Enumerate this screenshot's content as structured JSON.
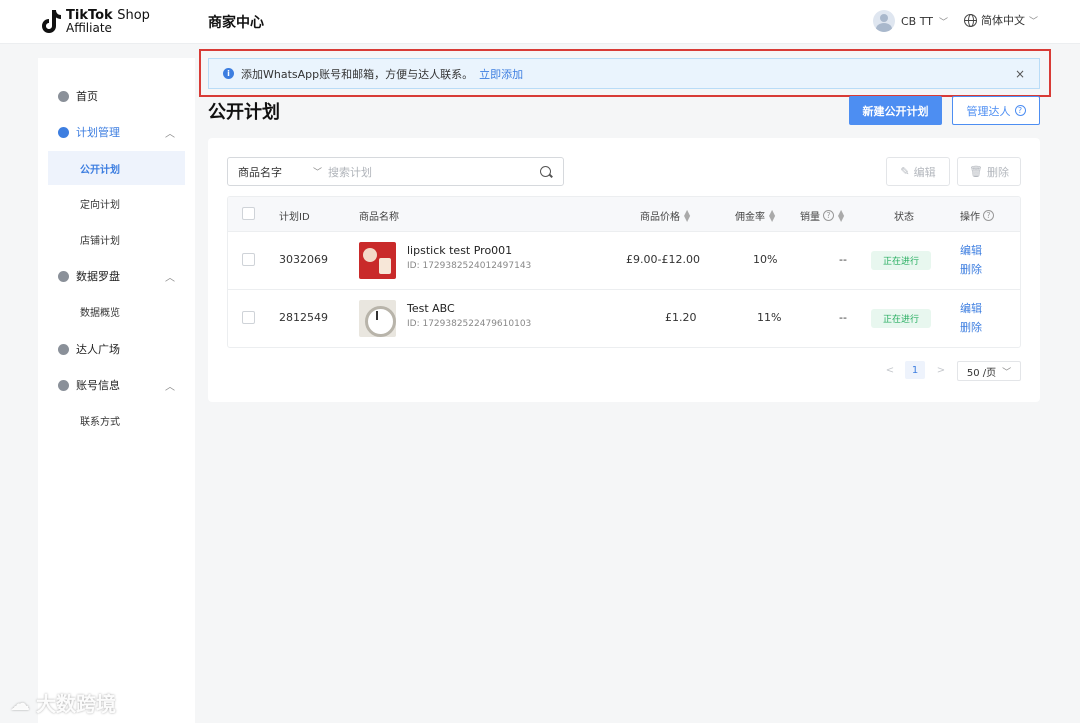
{
  "header": {
    "logo_brand": "TikTok",
    "logo_shop": "Shop",
    "logo_sub": "Affiliate",
    "title": "商家中心",
    "user_name": "CB TT",
    "language": "简体中文"
  },
  "sidebar": {
    "home": "首页",
    "plan_mgmt": "计划管理",
    "public_plan": "公开计划",
    "targeted_plan": "定向计划",
    "shop_plan": "店铺计划",
    "data_compass": "数据罗盘",
    "data_overview": "数据概览",
    "creator_square": "达人广场",
    "account_info": "账号信息",
    "contact": "联系方式"
  },
  "banner": {
    "message": "添加WhatsApp账号和邮箱，方便与达人联系。",
    "link": "立即添加",
    "close": "×"
  },
  "page": {
    "title": "公开计划",
    "new_button": "新建公开计划",
    "manage_button": "管理达人"
  },
  "toolbar": {
    "select_label": "商品名字",
    "search_placeholder": "搜索计划",
    "edit_label": "编辑",
    "delete_label": "删除"
  },
  "table": {
    "headers": {
      "plan_id": "计划ID",
      "product_name": "商品名称",
      "price": "商品价格",
      "commission": "佣金率",
      "sales": "销量",
      "status": "状态",
      "actions": "操作"
    },
    "rows": [
      {
        "plan_id": "3032069",
        "product_name": "lipstick test Pro001",
        "product_id": "ID: 1729382524012497143",
        "price": "£9.00-£12.00",
        "commission": "10%",
        "sales": "--",
        "status": "正在进行",
        "edit": "编辑",
        "delete": "删除"
      },
      {
        "plan_id": "2812549",
        "product_name": "Test ABC",
        "product_id": "ID: 1729382522479610103",
        "price": "£1.20",
        "commission": "11%",
        "sales": "--",
        "status": "正在进行",
        "edit": "编辑",
        "delete": "删除"
      }
    ]
  },
  "pagination": {
    "prev": "<",
    "current_page": "1",
    "next": ">",
    "page_size": "50 /页"
  },
  "watermark": {
    "text": "大数跨境"
  },
  "colors": {
    "accent": "#4d8ef2",
    "status_green": "#27ae60",
    "highlight_red": "#d83b36"
  }
}
